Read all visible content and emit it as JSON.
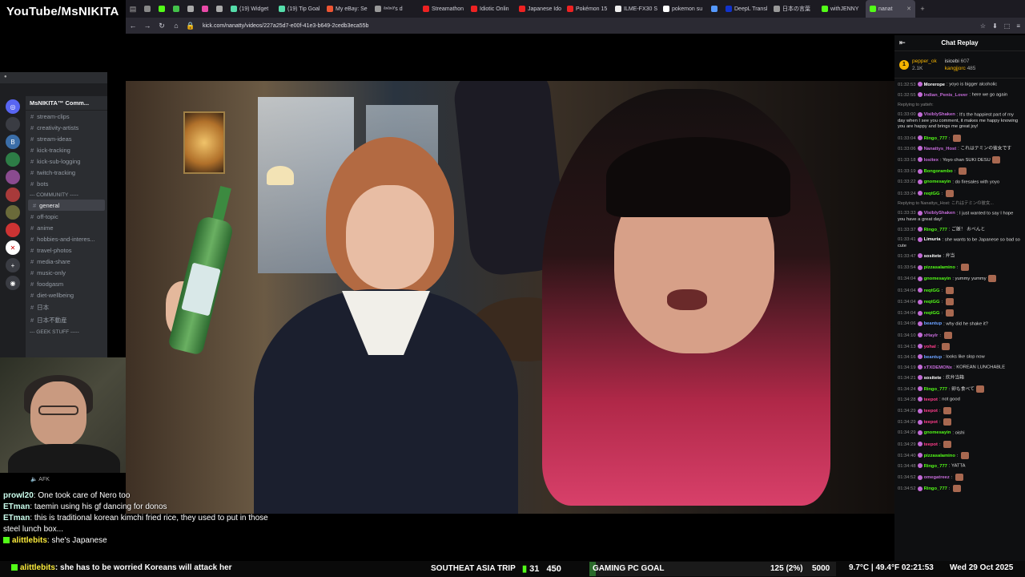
{
  "watermark": "YouTube/MsNIKITA",
  "browser": {
    "tabs": [
      {
        "label": "",
        "color": "#888"
      },
      {
        "label": "",
        "color": "#53fc18"
      },
      {
        "label": "",
        "color": "#43c24a"
      },
      {
        "label": "",
        "color": "#aaa"
      },
      {
        "label": "",
        "color": "#e94aa8"
      },
      {
        "label": "",
        "color": "#aaa"
      },
      {
        "label": "(19) Widget",
        "color": "#5da"
      },
      {
        "label": "(19) Tip Goal",
        "color": "#5da"
      },
      {
        "label": "My eBay: Se",
        "color": "#e53"
      },
      {
        "label": "ᵃⁿᵃⁿᵃ's d",
        "color": "#999"
      },
      {
        "label": "Streamathon",
        "color": "#e22"
      },
      {
        "label": "Idiotic Onlin",
        "color": "#e22"
      },
      {
        "label": "Japanese Ido",
        "color": "#e22"
      },
      {
        "label": "Pokémon 15",
        "color": "#e22"
      },
      {
        "label": "ILME-FX30 S",
        "color": "#eee"
      },
      {
        "label": "pokemon su",
        "color": "#fff"
      },
      {
        "label": "",
        "color": "#59f"
      },
      {
        "label": "DeepL Transl",
        "color": "#13c"
      },
      {
        "label": "日本の言葉",
        "color": "#999"
      },
      {
        "label": "withJENNY",
        "color": "#53fc18"
      },
      {
        "label": "nanat",
        "color": "#53fc18"
      }
    ],
    "url": "kick.com/nanatty/videos/227a25d7-e00f-41e3-b649-2cedb3eca55b"
  },
  "discord": {
    "server_name": "MsNIKITA™ Comm...",
    "channels": [
      {
        "name": "stream-clips",
        "type": "channel"
      },
      {
        "name": "creativity-artists",
        "type": "channel"
      },
      {
        "name": "stream-ideas",
        "type": "channel"
      },
      {
        "name": "kick-tracking",
        "type": "channel"
      },
      {
        "name": "kick-sub-logging",
        "type": "channel"
      },
      {
        "name": "twitch-tracking",
        "type": "channel"
      },
      {
        "name": "bots",
        "type": "channel"
      },
      {
        "name": "--- COMMUNITY -----",
        "type": "category"
      },
      {
        "name": "general",
        "type": "active"
      },
      {
        "name": "off-topic",
        "type": "channel"
      },
      {
        "name": "anime",
        "type": "channel"
      },
      {
        "name": "hobbies-and-interes...",
        "type": "channel"
      },
      {
        "name": "travel-photos",
        "type": "channel"
      },
      {
        "name": "media-share",
        "type": "channel"
      },
      {
        "name": "music-only",
        "type": "channel"
      },
      {
        "name": "foodgasm",
        "type": "channel"
      },
      {
        "name": "diet-wellbeing",
        "type": "channel"
      },
      {
        "name": "日本",
        "type": "channel"
      },
      {
        "name": "日本不動産",
        "type": "channel"
      },
      {
        "name": "--- GEEK STUFF -----",
        "type": "category"
      }
    ],
    "afk_label": "AFK"
  },
  "chat_replay": {
    "title": "Chat Replay",
    "leaders": [
      {
        "rank": "1",
        "name": "pepper_ok",
        "value": "2.1K"
      },
      {
        "name": "isicebi",
        "value": "607"
      },
      {
        "name": "kangjjorc",
        "value": "485"
      }
    ],
    "messages": [
      {
        "ts": "01:32:53",
        "user": "Morerope",
        "color": "#ffffff",
        "text": "yoyo is bigger alcoholic"
      },
      {
        "ts": "01:32:55",
        "user": "Indian_Penis_Lover",
        "color": "#c46bd8",
        "text": "here we go again"
      },
      {
        "reply": "Replying to yatteh:"
      },
      {
        "ts": "01:33:00",
        "user": "VisiblyShaken",
        "color": "#c46bd8",
        "text": "It's the happiest part of my day when I see you comment, it makes me happy knowing you are happy and brings me great joy!"
      },
      {
        "ts": "01:33:04",
        "user": "Ringo_777",
        "color": "#53fc18",
        "text": "",
        "emote": true
      },
      {
        "ts": "01:33:06",
        "user": "Nanattys_Host",
        "color": "#c46bd8",
        "text": "これはテミンの彼女です"
      },
      {
        "ts": "01:33:18",
        "user": "lositex",
        "color": "#c46bd8",
        "text": "Yoyo chan SUKI DESU",
        "emote": true
      },
      {
        "ts": "01:33:19",
        "user": "Bongorambo",
        "color": "#53fc18",
        "text": "",
        "emote": true
      },
      {
        "ts": "01:33:22",
        "user": "gnomesayin",
        "color": "#53fc18",
        "text": "do firesales with yoyo"
      },
      {
        "ts": "01:33:24",
        "user": "reqtGG",
        "color": "#53fc18",
        "text": "",
        "emote": true
      },
      {
        "reply": "Replying to Nanattys_Host: これはテミンの彼女..."
      },
      {
        "ts": "01:33:33",
        "user": "VisiblyShaken",
        "color": "#c46bd8",
        "text": "I just wanted to say I hope you have a great day!"
      },
      {
        "ts": "01:33:37",
        "user": "Ringo_777",
        "color": "#53fc18",
        "text": "ご飯！ おべんと"
      },
      {
        "ts": "01:33:41",
        "user": "Limuria",
        "color": "#ffffff",
        "text": "she wants to be Japanese so bad so cute"
      },
      {
        "ts": "01:33:47",
        "user": "sositete",
        "color": "#ffffff",
        "text": "弁当"
      },
      {
        "ts": "01:33:54",
        "user": "pizzasalamino",
        "color": "#53fc18",
        "text": "",
        "emote": true
      },
      {
        "ts": "01:34:04",
        "user": "gnomesayin",
        "color": "#53fc18",
        "text": "yummy yummy",
        "emote": true
      },
      {
        "ts": "01:34:04",
        "user": "reqtGG",
        "color": "#53fc18",
        "text": "",
        "emote": true
      },
      {
        "ts": "01:34:04",
        "user": "reqtGG",
        "color": "#53fc18",
        "text": "",
        "emote": true
      },
      {
        "ts": "01:34:04",
        "user": "reqtGG",
        "color": "#53fc18",
        "text": "",
        "emote": true
      },
      {
        "ts": "01:34:06",
        "user": "beantup",
        "color": "#6aa0ff",
        "text": "why did he shake it?"
      },
      {
        "ts": "01:34:10",
        "user": "xHaylr",
        "color": "#c46bd8",
        "text": "",
        "emote": true
      },
      {
        "ts": "01:34:13",
        "user": "yohal",
        "color": "#ff3c8a",
        "text": "",
        "emote": true
      },
      {
        "ts": "01:34:16",
        "user": "beantup",
        "color": "#6aa0ff",
        "text": "looks like slop now"
      },
      {
        "ts": "01:34:19",
        "user": "xTXDEMONx",
        "color": "#c46bd8",
        "text": "KOREAN LUNCHABLE"
      },
      {
        "ts": "01:34:21",
        "user": "sositete",
        "color": "#ffffff",
        "text": "炊弁当箱"
      },
      {
        "ts": "01:34:24",
        "user": "Ringo_777",
        "color": "#53fc18",
        "text": "卵も食べて",
        "emote": true
      },
      {
        "ts": "01:34:28",
        "user": "teepot",
        "color": "#ff3c8a",
        "text": "not good"
      },
      {
        "ts": "01:34:29",
        "user": "teepot",
        "color": "#ff3c8a",
        "text": "",
        "emote": true
      },
      {
        "ts": "01:34:29",
        "user": "teepot",
        "color": "#ff3c8a",
        "text": "",
        "emote": true
      },
      {
        "ts": "01:34:29",
        "user": "gnomesayin",
        "color": "#53fc18",
        "text": "oishi"
      },
      {
        "ts": "01:34:29",
        "user": "teepot",
        "color": "#ff3c8a",
        "text": "",
        "emote": true
      },
      {
        "ts": "01:34:40",
        "user": "pizzasalamino",
        "color": "#53fc18",
        "text": "",
        "emote": true
      },
      {
        "ts": "01:34:48",
        "user": "Ringo_777",
        "color": "#53fc18",
        "text": "YATTA"
      },
      {
        "ts": "01:34:52",
        "user": "omegatreez",
        "color": "#c46bd8",
        "text": "",
        "emote": true
      },
      {
        "ts": "01:34:52",
        "user": "Ringo_777",
        "color": "#53fc18",
        "text": "",
        "emote": true
      }
    ]
  },
  "overlay_chat": [
    {
      "user": "prowl20",
      "text": ": One took care of Nero too"
    },
    {
      "user": "ETman",
      "text": ": taemin using his gf dancing for donos"
    },
    {
      "user": "ETman",
      "text": ": this is traditional korean kimchi fried rice, they used to put in those steel lunch box..."
    },
    {
      "user": "alittlebits",
      "text": ": she's Japanese"
    }
  ],
  "bottom_bar": {
    "chat_user": "alittlebits",
    "chat_text": ": she has to be worried Koreans will attack her",
    "goal1_label": "SOUTHEAT ASIA TRIP",
    "goal1_current": "31",
    "goal1_target": "450",
    "goal2_label": "GAMING PC GOAL",
    "goal2_current": "125 (2%)",
    "goal2_target": "5000",
    "goal2_progress": 0.025,
    "weather": "9.7°C | 49.4°F",
    "time": "02:21:53",
    "date": "Wed 29 Oct 2025"
  }
}
